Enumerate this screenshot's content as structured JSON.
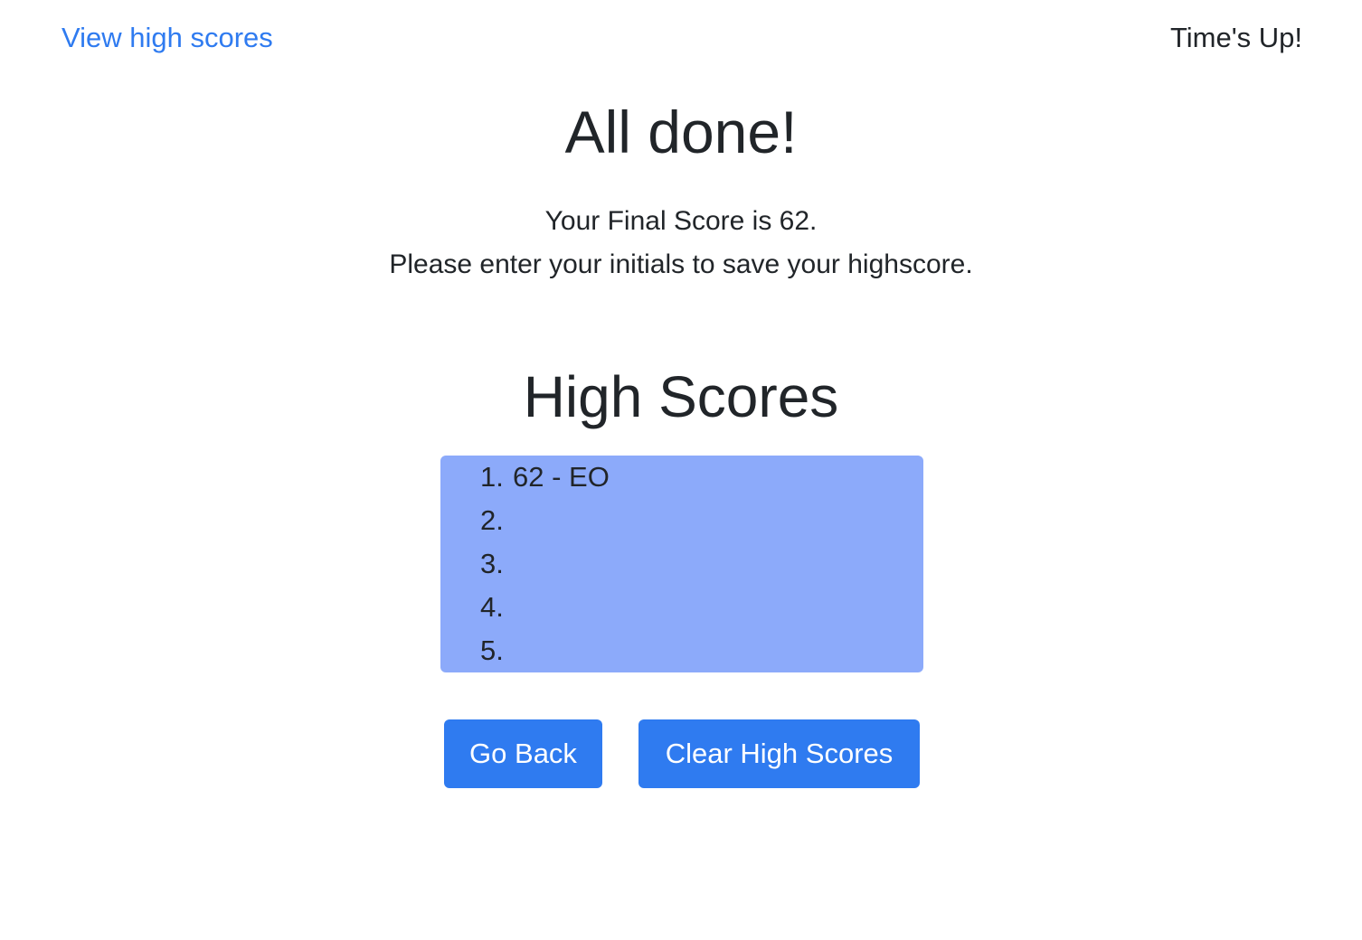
{
  "header": {
    "view_scores_link": "View high scores",
    "timer_text": "Time's Up!"
  },
  "results": {
    "title": "All done!",
    "final_score_text": "Your Final Score is 62.",
    "instruction_text": "Please enter your initials to save your highscore."
  },
  "high_scores": {
    "title": "High Scores",
    "entries": [
      {
        "rank": "1.",
        "text": "62 - EO"
      },
      {
        "rank": "2.",
        "text": ""
      },
      {
        "rank": "3.",
        "text": ""
      },
      {
        "rank": "4.",
        "text": ""
      },
      {
        "rank": "5.",
        "text": ""
      }
    ]
  },
  "buttons": {
    "go_back": "Go Back",
    "clear_scores": "Clear High Scores"
  },
  "colors": {
    "accent": "#2f7bf0",
    "list_background": "#8caafa",
    "text": "#212529"
  }
}
